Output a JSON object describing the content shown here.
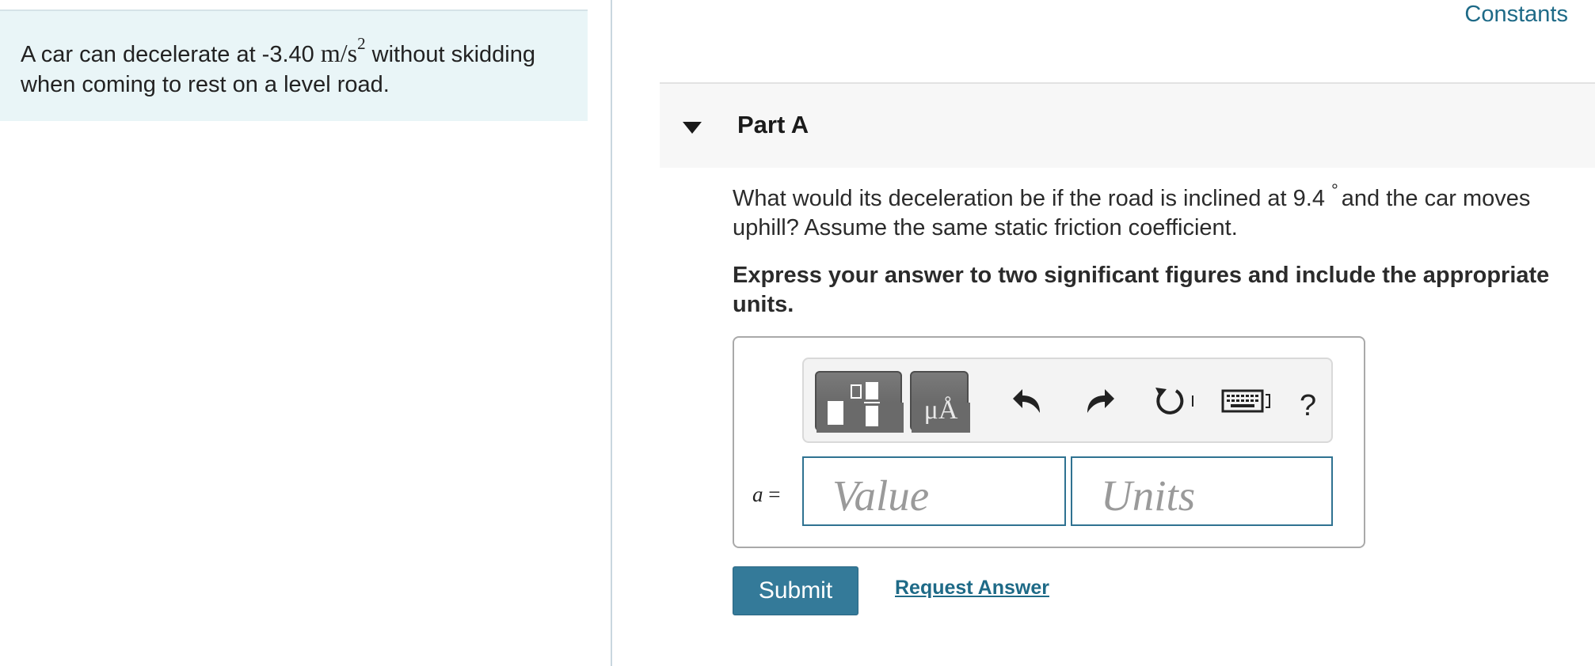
{
  "problem": {
    "text_before": "A car can decelerate at -3.40 ",
    "unit_base": "m/s",
    "unit_exponent": "2",
    "text_after": " without skidding when coming to rest on a level road."
  },
  "header": {
    "constants_label": "Constants"
  },
  "part": {
    "title": "Part A"
  },
  "question": {
    "text_before": "What would its deceleration be if the road is inclined at 9.4",
    "degree_symbol": "°",
    "text_after": "and the car moves uphill? Assume the same static friction coefficient.",
    "instruction": "Express your answer to two significant figures and include the appropriate units."
  },
  "toolbar": {
    "buttons": [
      {
        "icon": "templates-icon"
      },
      {
        "icon": "units-icon",
        "label": "μÅ"
      },
      {
        "icon": "undo-icon"
      },
      {
        "icon": "redo-icon"
      },
      {
        "icon": "reset-icon"
      },
      {
        "icon": "keyboard-icon"
      },
      {
        "icon": "help-icon",
        "label": "?"
      }
    ]
  },
  "answer": {
    "variable": "a",
    "equals": "=",
    "value_placeholder": "Value",
    "units_placeholder": "Units"
  },
  "actions": {
    "submit_label": "Submit",
    "request_answer_label": "Request Answer"
  },
  "colors": {
    "accent": "#347a99",
    "link": "#1e6a87",
    "problem_panel_bg": "#e9f5f7"
  }
}
